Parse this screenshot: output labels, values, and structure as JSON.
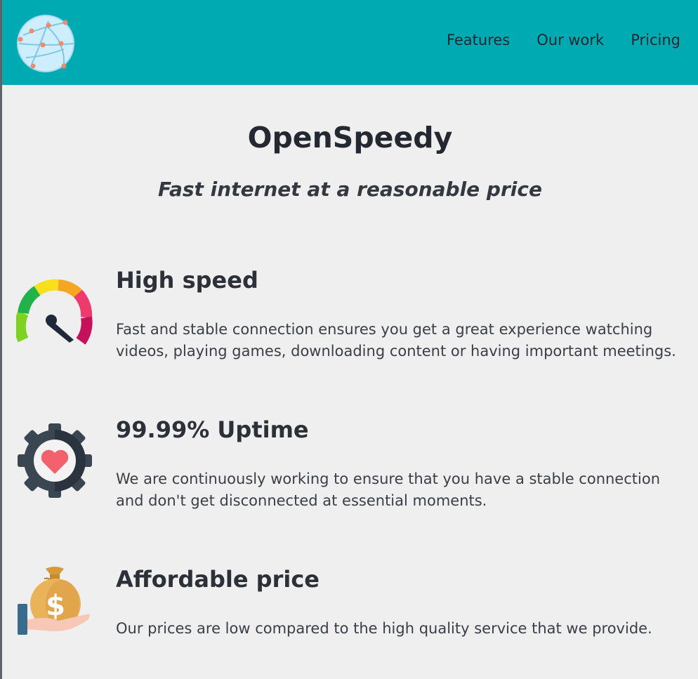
{
  "header": {
    "logo_icon": "globe-network-icon",
    "nav": {
      "features": "Features",
      "our_work": "Our work",
      "pricing": "Pricing"
    }
  },
  "hero": {
    "title": "OpenSpeedy",
    "subtitle": "Fast internet at a reasonable price"
  },
  "features": [
    {
      "icon": "speedometer-icon",
      "title": "High speed",
      "description": "Fast and stable connection ensures you get a great experience watching videos, playing games, downloading content or having important meetings."
    },
    {
      "icon": "gear-heart-icon",
      "title": "99.99% Uptime",
      "description": "We are continuously working to ensure that you have a stable connection and don't get disconnected at essential moments."
    },
    {
      "icon": "money-bag-hand-icon",
      "title": "Affordable price",
      "description": "Our prices are low compared to the high quality service that we provide."
    }
  ],
  "colors": {
    "header_bg": "#00aab3",
    "page_bg": "#efefef",
    "text": "#2b2f36"
  }
}
